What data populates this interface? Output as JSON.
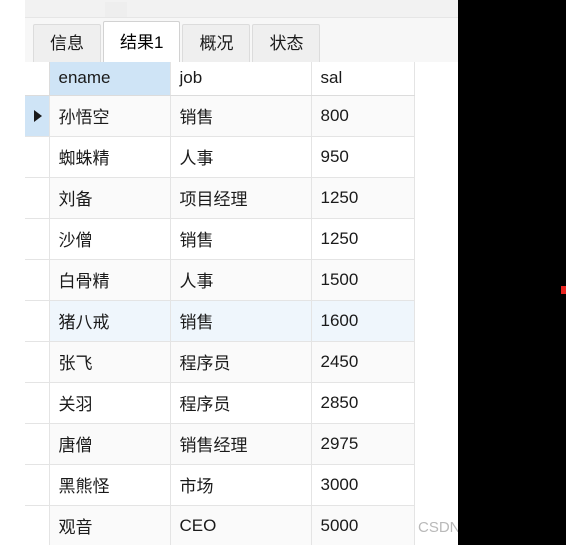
{
  "tabs": [
    {
      "label": "信息",
      "active": false
    },
    {
      "label": "结果1",
      "active": true
    },
    {
      "label": "概况",
      "active": false
    },
    {
      "label": "状态",
      "active": false
    }
  ],
  "grid": {
    "columns": [
      "ename",
      "job",
      "sal"
    ],
    "selected_column": "ename",
    "current_row_index": 0,
    "highlight_row_index": 5,
    "rows": [
      {
        "ename": "孙悟空",
        "job": "销售",
        "sal": "800"
      },
      {
        "ename": "蜘蛛精",
        "job": "人事",
        "sal": "950"
      },
      {
        "ename": "刘备",
        "job": "项目经理",
        "sal": "1250"
      },
      {
        "ename": "沙僧",
        "job": "销售",
        "sal": "1250"
      },
      {
        "ename": "白骨精",
        "job": "人事",
        "sal": "1500"
      },
      {
        "ename": "猪八戒",
        "job": "销售",
        "sal": "1600"
      },
      {
        "ename": "张飞",
        "job": "程序员",
        "sal": "2450"
      },
      {
        "ename": "关羽",
        "job": "程序员",
        "sal": "2850"
      },
      {
        "ename": "唐僧",
        "job": "销售经理",
        "sal": "2975"
      },
      {
        "ename": "黑熊怪",
        "job": "市场",
        "sal": "3000"
      },
      {
        "ename": "观音",
        "job": "CEO",
        "sal": "5000"
      }
    ]
  },
  "watermark": {
    "text": "CSDN @一个刘"
  },
  "colors": {
    "selected_header": "#cfe4f6",
    "row_highlight": "#eff6fc",
    "alt_row": "#fafafa",
    "red_mark": "#e8241f",
    "mask": "#000000"
  }
}
